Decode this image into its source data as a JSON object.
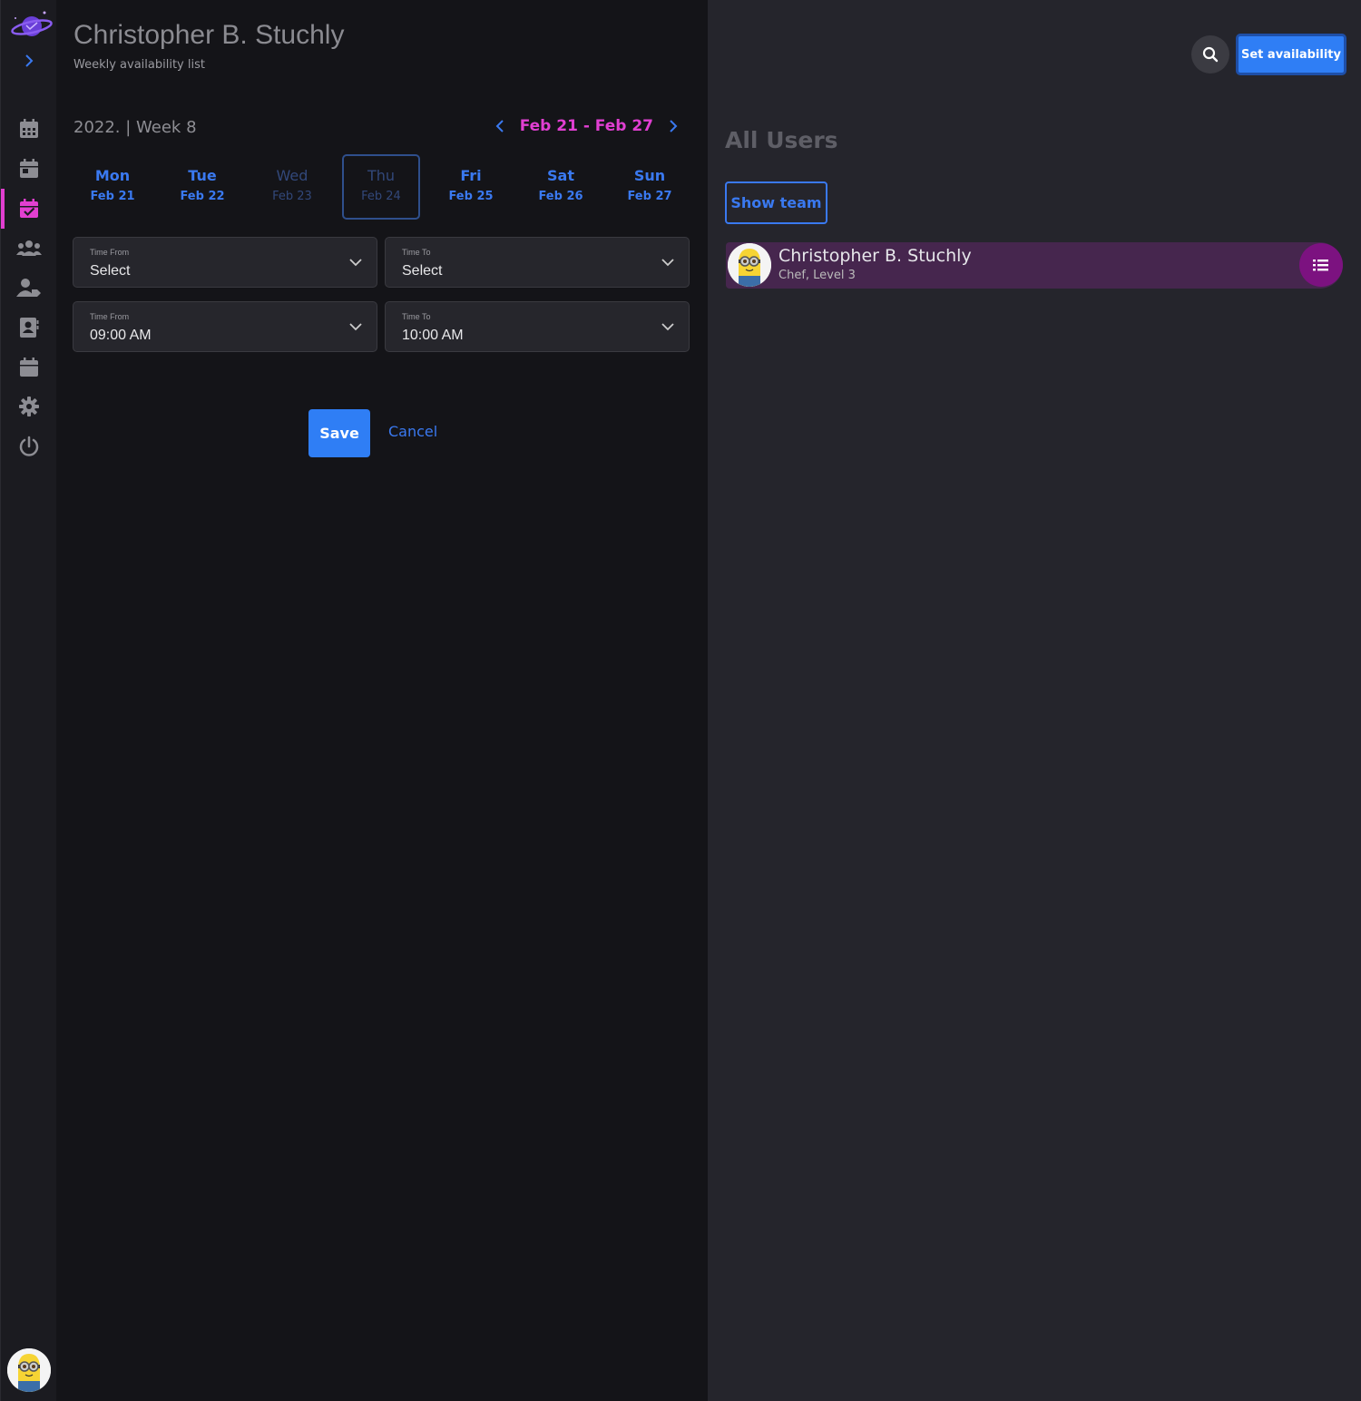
{
  "header": {
    "title": "Christopher B. Stuchly",
    "subtitle": "Weekly availability list"
  },
  "week": {
    "label": "2022. | Week 8",
    "range": "Feb 21 - Feb 27"
  },
  "days": [
    {
      "name": "Mon",
      "date": "Feb 21"
    },
    {
      "name": "Tue",
      "date": "Feb 22"
    },
    {
      "name": "Wed",
      "date": "Feb 23"
    },
    {
      "name": "Thu",
      "date": "Feb 24"
    },
    {
      "name": "Fri",
      "date": "Feb 25"
    },
    {
      "name": "Sat",
      "date": "Feb 26"
    },
    {
      "name": "Sun",
      "date": "Feb 27"
    }
  ],
  "time_rows": [
    {
      "from_label": "Time From",
      "from_value": "Select",
      "to_label": "Time To",
      "to_value": "Select"
    },
    {
      "from_label": "Time From",
      "from_value": "09:00 AM",
      "to_label": "Time To",
      "to_value": "10:00 AM"
    }
  ],
  "actions": {
    "save": "Save",
    "cancel": "Cancel"
  },
  "right": {
    "set_availability": "Set availability",
    "heading": "All Users",
    "show_team": "Show team",
    "user": {
      "name": "Christopher B. Stuchly",
      "role": "Chef, Level 3"
    }
  },
  "colors": {
    "accent_blue": "#2f7ef5",
    "accent_pink": "#e13fd2",
    "user_row": "#46264e",
    "menu_button": "#7c1280"
  },
  "sidebar_icons": [
    "calendar-icon",
    "calendar-day-icon",
    "calendar-check-icon",
    "users-icon",
    "user-tag-icon",
    "contact-card-icon",
    "calendar-alt-icon",
    "gear-icon",
    "power-icon"
  ]
}
